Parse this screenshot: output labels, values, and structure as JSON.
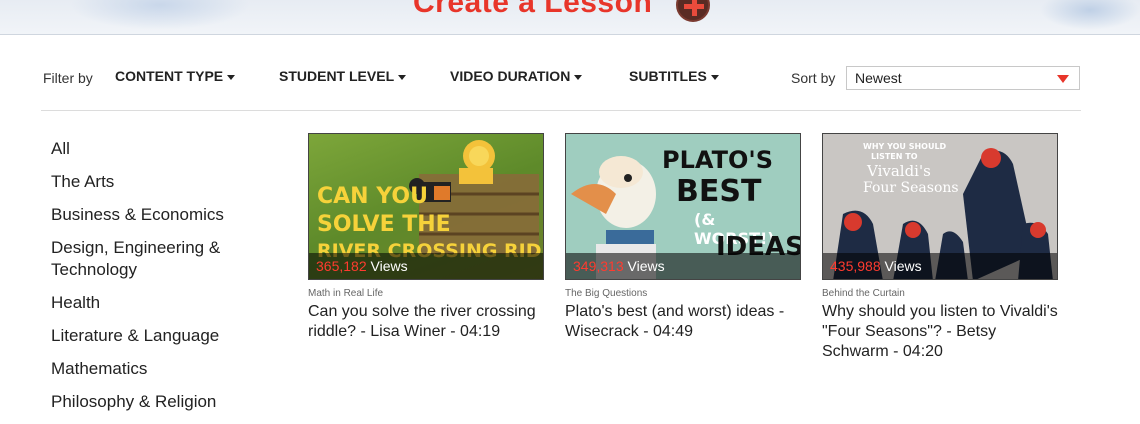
{
  "banner": {
    "title": "Create a Lesson"
  },
  "filters": {
    "label": "Filter by",
    "dropdowns": [
      "CONTENT TYPE",
      "STUDENT LEVEL",
      "VIDEO DURATION",
      "SUBTITLES"
    ],
    "sort_label": "Sort by",
    "sort_value": "Newest"
  },
  "sidebar": {
    "items": [
      "All",
      "The Arts",
      "Business & Economics",
      "Design, Engineering & Technology",
      "Health",
      "Literature & Language",
      "Mathematics",
      "Philosophy & Religion"
    ]
  },
  "cards": [
    {
      "views_count": "365,182",
      "views_word": "Views",
      "category": "Math in Real Life",
      "title": "Can you solve the river crossing riddle? - Lisa Winer - 04:19",
      "thumb_text": [
        "CAN YOU",
        "SOLVE THE",
        "RIVER CROSSING RIDDLE?"
      ]
    },
    {
      "views_count": "349,313",
      "views_word": "Views",
      "category": "The Big Questions",
      "title": "Plato's best (and worst) ideas - Wisecrack - 04:49",
      "thumb_text": [
        "PLATO'S",
        "BEST",
        "(& WORST!)",
        "IDEAS"
      ]
    },
    {
      "views_count": "435,988",
      "views_word": "Views",
      "category": "Behind the Curtain",
      "title": "Why should you listen to Vivaldi's \"Four Seasons\"? - Betsy Schwarm - 04:20",
      "thumb_text": [
        "WHY YOU SHOULD",
        "LISTEN TO",
        "Vivaldi's",
        "Four Seasons"
      ]
    }
  ],
  "colors": {
    "accent": "#e8352a",
    "text": "#222222"
  }
}
